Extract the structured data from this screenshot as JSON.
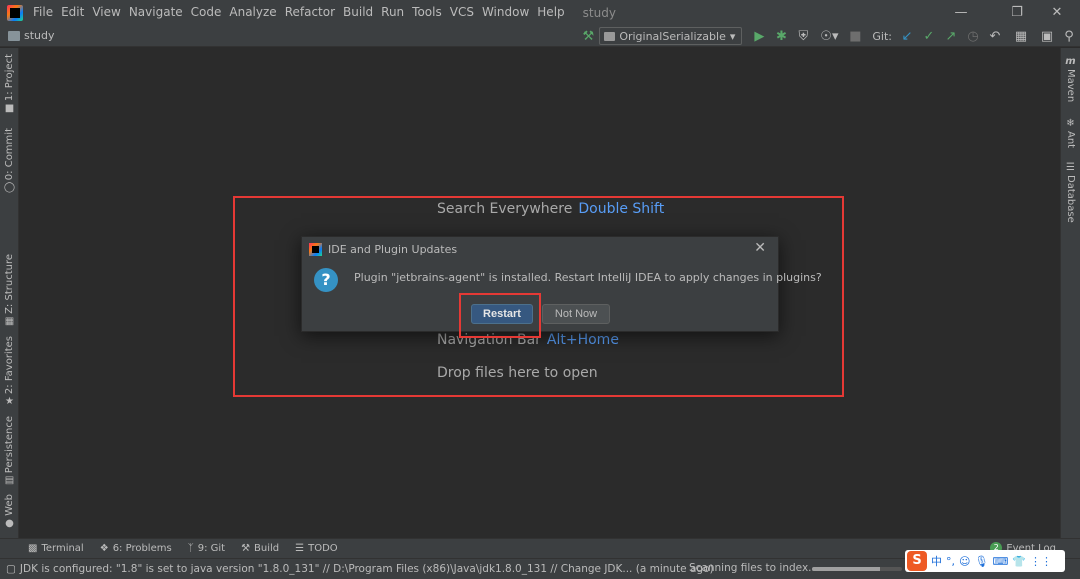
{
  "menubar": {
    "items": [
      "File",
      "Edit",
      "View",
      "Navigate",
      "Code",
      "Analyze",
      "Refactor",
      "Build",
      "Run",
      "Tools",
      "VCS",
      "Window",
      "Help"
    ],
    "window_title": "study"
  },
  "toolbar": {
    "project": "study",
    "run_config": "OriginalSerializable",
    "git_label": "Git:"
  },
  "left_tabs": [
    "1: Project",
    "0: Commit",
    "Z: Structure",
    "2: Favorites",
    "Persistence",
    "Web"
  ],
  "right_tabs": [
    "Maven",
    "Ant",
    "Database"
  ],
  "welcome": {
    "search": {
      "label": "Search Everywhere",
      "key": "Double Shift"
    },
    "navbar": {
      "label": "Navigation Bar",
      "key": "Alt+Home"
    },
    "drop": "Drop files here to open"
  },
  "dialog": {
    "title": "IDE and Plugin Updates",
    "message": "Plugin \"jetbrains-agent\" is installed. Restart IntelliJ IDEA to apply changes in plugins?",
    "restart": "Restart",
    "not_now": "Not Now"
  },
  "bottom_tabs": {
    "terminal": "Terminal",
    "problems": "6: Problems",
    "git": "9: Git",
    "build": "Build",
    "todo": "TODO",
    "event_log": "Event Log",
    "event_count": "2"
  },
  "status": {
    "message": "JDK is configured: \"1.8\" is set to java version \"1.8.0_131\" // D:\\Program Files (x86)\\Java\\jdk1.8.0_131 // Change JDK... (a minute ago)",
    "progress_text": "Scanning files to index...",
    "progress_fraction": 0.75
  },
  "ime": {
    "logo": "S",
    "items": [
      "中",
      "°,",
      "☺",
      "🎙",
      "⌨",
      "👕",
      "⋮⋮"
    ]
  }
}
